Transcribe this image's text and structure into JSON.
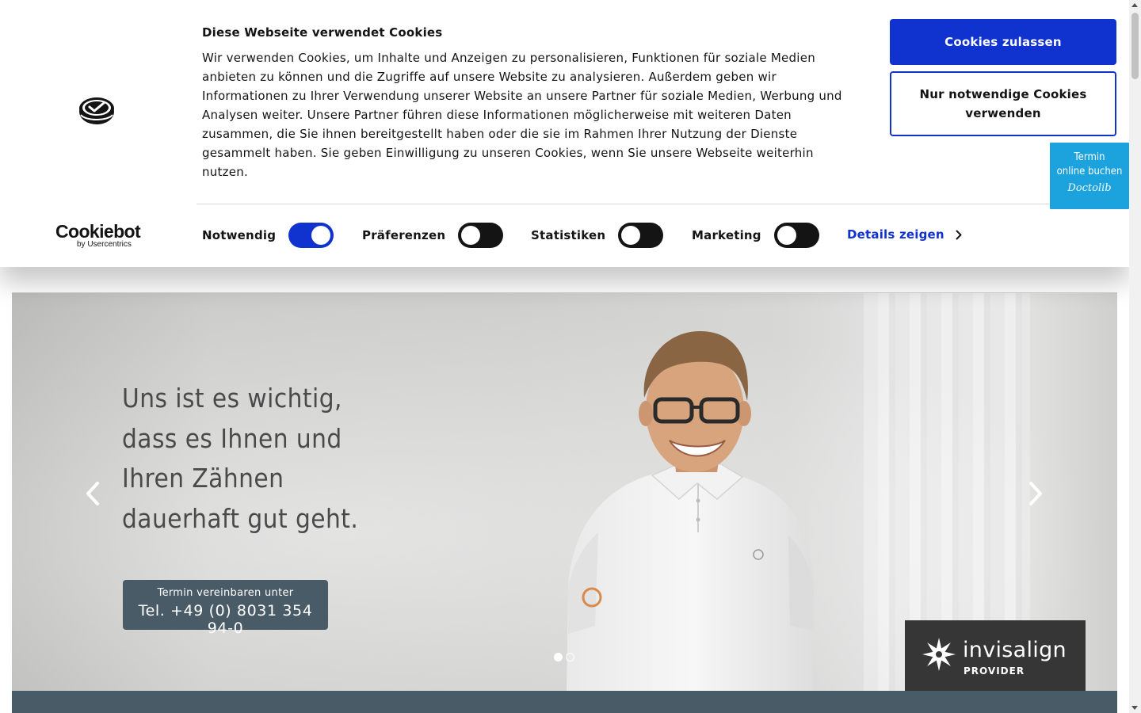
{
  "cookie_banner": {
    "title": "Diese Webseite verwendet Cookies",
    "text": "Wir verwenden Cookies, um Inhalte und Anzeigen zu personalisieren, Funktionen für soziale Medien anbieten zu können und die Zugriffe auf unsere Website zu analysieren. Außerdem geben wir Informationen zu Ihrer Verwendung unserer Website an unsere Partner für soziale Medien, Werbung und Analysen weiter. Unsere Partner führen diese Informationen möglicherweise mit weiteren Daten zusammen, die Sie ihnen bereitgestellt haben oder die sie im Rahmen Ihrer Nutzung der Dienste gesammelt haben. Sie geben Einwilligung zu unseren Cookies, wenn Sie unsere Webseite weiterhin nutzen.",
    "allow_button": "Cookies zulassen",
    "necessary_button": "Nur notwendige Cookies verwenden",
    "brand_name": "Cookiebot",
    "brand_sub": "by Usercentrics",
    "toggles": [
      {
        "label": "Notwendig",
        "on": true
      },
      {
        "label": "Präferenzen",
        "on": false
      },
      {
        "label": "Statistiken",
        "on": false
      },
      {
        "label": "Marketing",
        "on": false
      }
    ],
    "details_link": "Details zeigen",
    "accent_color": "#1032cf"
  },
  "doctolib_widget": {
    "line1": "Termin",
    "line2": "online buchen",
    "brand": "Doctolib",
    "color": "#1ca2dd"
  },
  "hero": {
    "headline_lines": [
      "Uns ist es wichtig,",
      "dass es Ihnen und",
      "Ihren Zähnen",
      "dauerhaft gut geht."
    ],
    "phone_caption": "Termin vereinbaren unter",
    "phone_number": "Tel. +49 (0) 8031 354 94-0",
    "slide_count": 2,
    "active_slide": 1,
    "badge_name": "invisalign",
    "badge_sub": "PROVIDER",
    "bar_color": "#4a5b68"
  },
  "icons": {
    "prev": "chevron-left-icon",
    "next": "chevron-right-icon",
    "cookie_logo": "cookie-check-icon",
    "details_chevron": "chevron-right-icon",
    "badge_star": "starburst-icon"
  }
}
